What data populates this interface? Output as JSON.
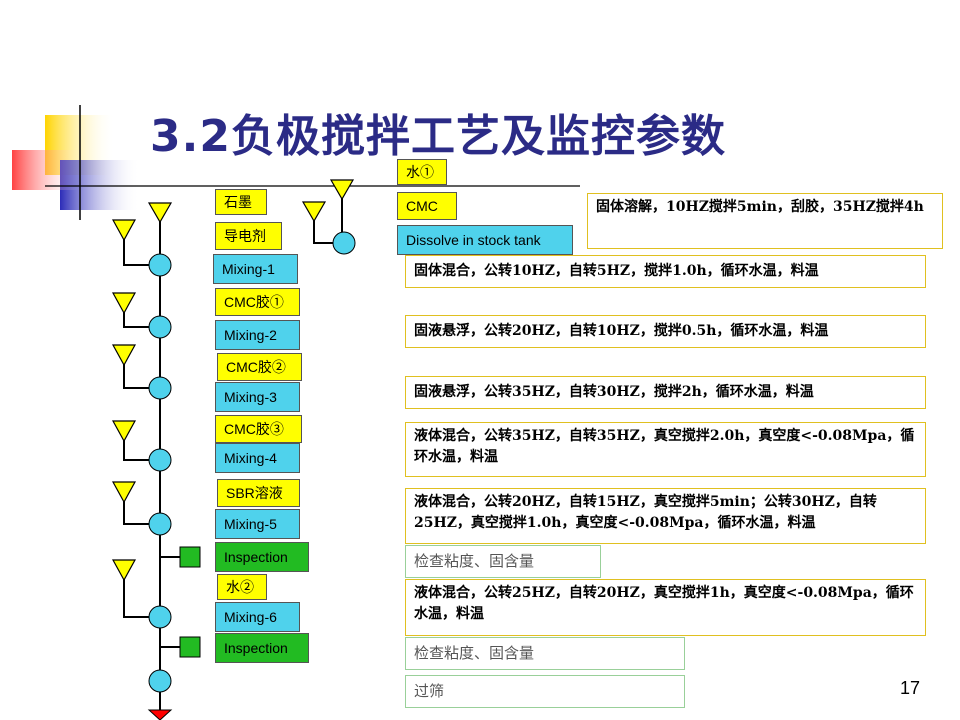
{
  "title": "3.2负极搅拌工艺及监控参数",
  "page_number": "17",
  "labels": {
    "water1": "水①",
    "cmc": "CMC",
    "dissolve": "Dissolve in stock tank",
    "graphite": "石墨",
    "conductive": "导电剂",
    "mixing1": "Mixing-1",
    "cmc_glue1": "CMC胶①",
    "mixing2": "Mixing-2",
    "cmc_glue2": "CMC胶②",
    "mixing3": "Mixing-3",
    "cmc_glue3": "CMC胶③",
    "mixing4": "Mixing-4",
    "sbr": "SBR溶液",
    "mixing5": "Mixing-5",
    "inspection1": "Inspection",
    "water2": "水②",
    "mixing6": "Mixing-6",
    "inspection2": "Inspection"
  },
  "notes": {
    "dissolve": "固体溶解，10HZ搅拌5min，刮胶，35HZ搅拌4h",
    "mixing1": "固体混合，公转10HZ，自转5HZ，搅拌1.0h，循环水温，料温",
    "mixing2": "固液悬浮，公转20HZ，自转10HZ，搅拌0.5h，循环水温，料温",
    "mixing3": "固液悬浮，公转35HZ，自转30HZ，搅拌2h，循环水温，料温",
    "mixing4": "液体混合，公转35HZ，自转35HZ，真空搅拌2.0h，真空度<-0.08Mpa，循环水温，料温",
    "mixing5": "液体混合，公转20HZ，自转15HZ，真空搅拌5min；公转30HZ，自转25HZ，真空搅拌1.0h，真空度<-0.08Mpa，循环水温，料温",
    "inspection1": "检查粘度、固含量",
    "mixing6": "液体混合，公转25HZ，自转20HZ，真空搅拌1h，真空度<-0.08Mpa，循环水温，料温",
    "inspection2": "检查粘度、固含量",
    "sieve": "过筛"
  },
  "colors": {
    "title": "#2b2b86",
    "yellow_box": "#ffff00",
    "cyan_box": "#4fd2ec",
    "green_box": "#22bb22",
    "node": "#4fd2ec",
    "end_marker": "#ff0000",
    "note_border": "#e0c020",
    "inspection_note_border": "#99d099"
  }
}
